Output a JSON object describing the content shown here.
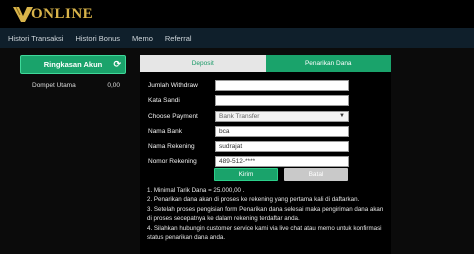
{
  "brand": {
    "logo_text": "ONLINE"
  },
  "nav": {
    "items": [
      "Histori Transaksi",
      "Histori Bonus",
      "Memo",
      "Referral"
    ]
  },
  "sidebar": {
    "title": "Ringkasan Akun",
    "wallet_label": "Dompet Utama",
    "wallet_value": "0,00"
  },
  "tabs": {
    "deposit": "Deposit",
    "withdraw": "Penarikan Dana"
  },
  "form": {
    "amount_label": "Jumlah Withdraw",
    "amount_value": "",
    "password_label": "Kata Sandi",
    "password_value": "",
    "method_label": "Choose Payment",
    "method_value": "Bank Transfer",
    "bank_label": "Nama Bank",
    "bank_value": "bca",
    "account_name_label": "Nama Rekening",
    "account_name_value": "sudrajat",
    "account_number_label": "Nomor Rekening",
    "account_number_value": "489-512-****"
  },
  "buttons": {
    "send": "Kirim",
    "cancel": "Batal"
  },
  "notes": [
    "1. Minimal Tarik Dana = 25.000,00 .",
    "2. Penarikan dana akan di proses ke rekening yang pertama kali di daftarkan.",
    "3. Setelah proses pengisian form Penarikan dana selesai maka pengiriman dana akan di proses secepatnya ke dalam rekening terdaftar anda.",
    "4. Silahkan hubungin customer service kami via live chat atau memo untuk konfirmasi status penarikan dana anda."
  ],
  "colors": {
    "accent": "#1aa36b",
    "gold": "#d9b44a",
    "nav_bg": "#0f1f2b"
  }
}
